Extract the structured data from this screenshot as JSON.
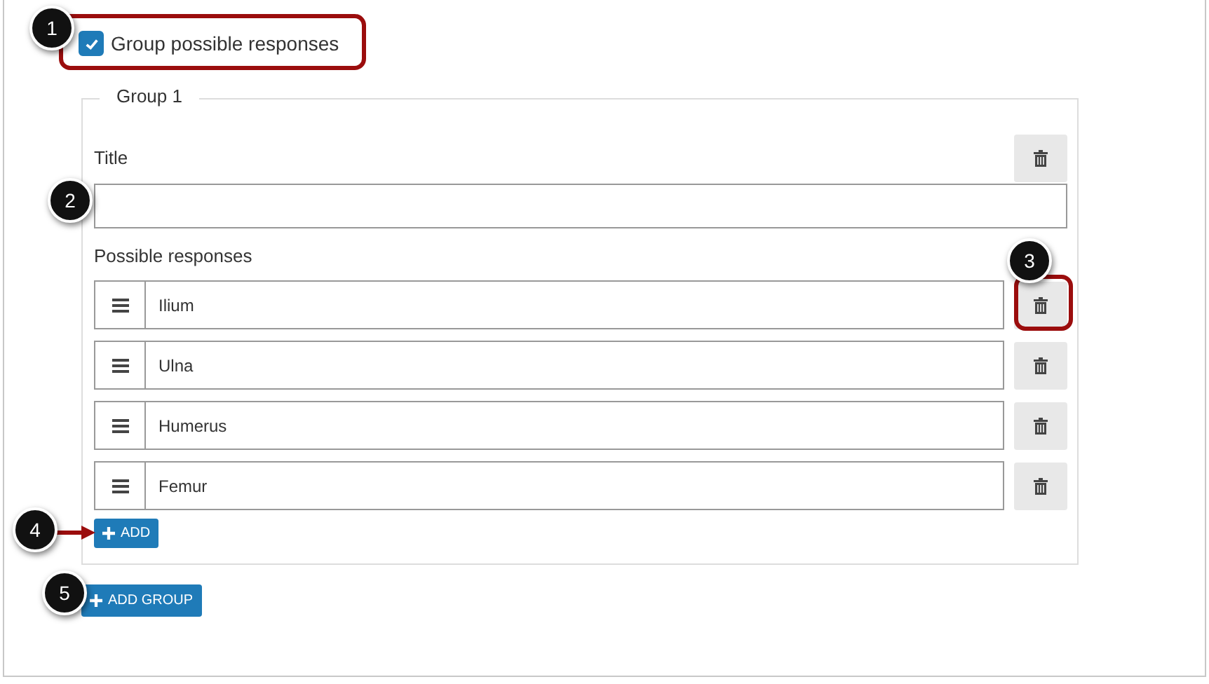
{
  "group_option": {
    "label": "Group possible responses",
    "checked": true
  },
  "group": {
    "legend": "Group 1",
    "title_label": "Title",
    "responses_label": "Possible responses",
    "responses": [
      {
        "value": "Ilium"
      },
      {
        "value": "Ulna"
      },
      {
        "value": "Humerus"
      },
      {
        "value": "Femur"
      }
    ],
    "add_button": "ADD"
  },
  "add_group_button": "ADD GROUP",
  "callouts": [
    "1",
    "2",
    "3",
    "4",
    "5"
  ]
}
